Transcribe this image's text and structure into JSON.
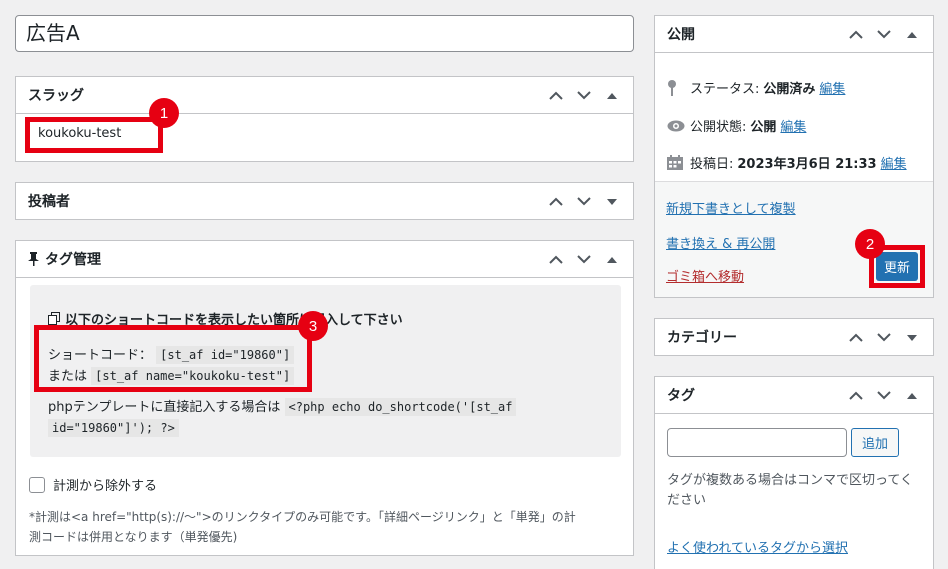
{
  "title": "広告A",
  "slug": {
    "heading": "スラッグ",
    "value": "koukoku-test"
  },
  "author": {
    "heading": "投稿者"
  },
  "tag_mgmt": {
    "heading": "タグ管理",
    "instruction": "以下のショートコードを表示したい箇所に記入して下さい",
    "shortcode_label": "ショートコード：",
    "shortcode_id": "[st_af id=\"19860\"]",
    "or_label": "または",
    "shortcode_name": "[st_af name=\"koukoku-test\"]",
    "php_label": "phpテンプレートに直接記入する場合は",
    "php_code_1": "<?php echo do_shortcode('[st_af",
    "php_code_2": "id=\"19860\"]'); ?>",
    "exclude_label": "計測から除外する",
    "note_1": "*計測は<a href=\"http(s)://〜\">のリンクタイプのみ可能です。「詳細ページリンク」と「単発」の計",
    "note_2": "測コードは併用となります（単発優先)"
  },
  "publish": {
    "heading": "公開",
    "status_label": "ステータス:",
    "status_value": "公開済み",
    "visibility_label": "公開状態:",
    "visibility_value": "公開",
    "date_label": "投稿日:",
    "date_value": "2023年3月6日 21:33",
    "edit": "編集",
    "copy_draft": "新規下書きとして複製",
    "rewrite": "書き換え & 再公開",
    "trash": "ゴミ箱へ移動",
    "update": "更新"
  },
  "category": {
    "heading": "カテゴリー"
  },
  "tags": {
    "heading": "タグ",
    "add": "追加",
    "hint_1": "タグが複数ある場合はコンマで区切ってく",
    "hint_2": "ださい",
    "popular": "よく使われているタグから選択"
  },
  "badges": [
    "1",
    "2",
    "3"
  ],
  "colors": {
    "accent": "#2271b1",
    "annotation": "#e60012",
    "trash": "#b32d2e"
  }
}
